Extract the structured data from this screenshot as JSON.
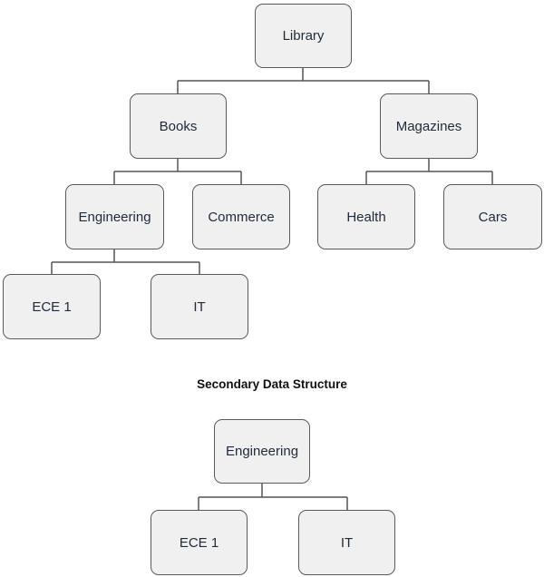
{
  "primary_tree": {
    "root": "Library",
    "level1": [
      "Books",
      "Magazines"
    ],
    "books_children": [
      "Engineering",
      "Commerce"
    ],
    "magazines_children": [
      "Health",
      "Cars"
    ],
    "engineering_children": [
      "ECE 1",
      "IT"
    ]
  },
  "secondary_title": "Secondary Data Structure",
  "secondary_tree": {
    "root": "Engineering",
    "children": [
      "ECE 1",
      "IT"
    ]
  },
  "colors": {
    "node_fill": "#f0f0f0",
    "node_border": "#5a5a5a",
    "connector": "#555555",
    "text": "#1f2a3a"
  }
}
